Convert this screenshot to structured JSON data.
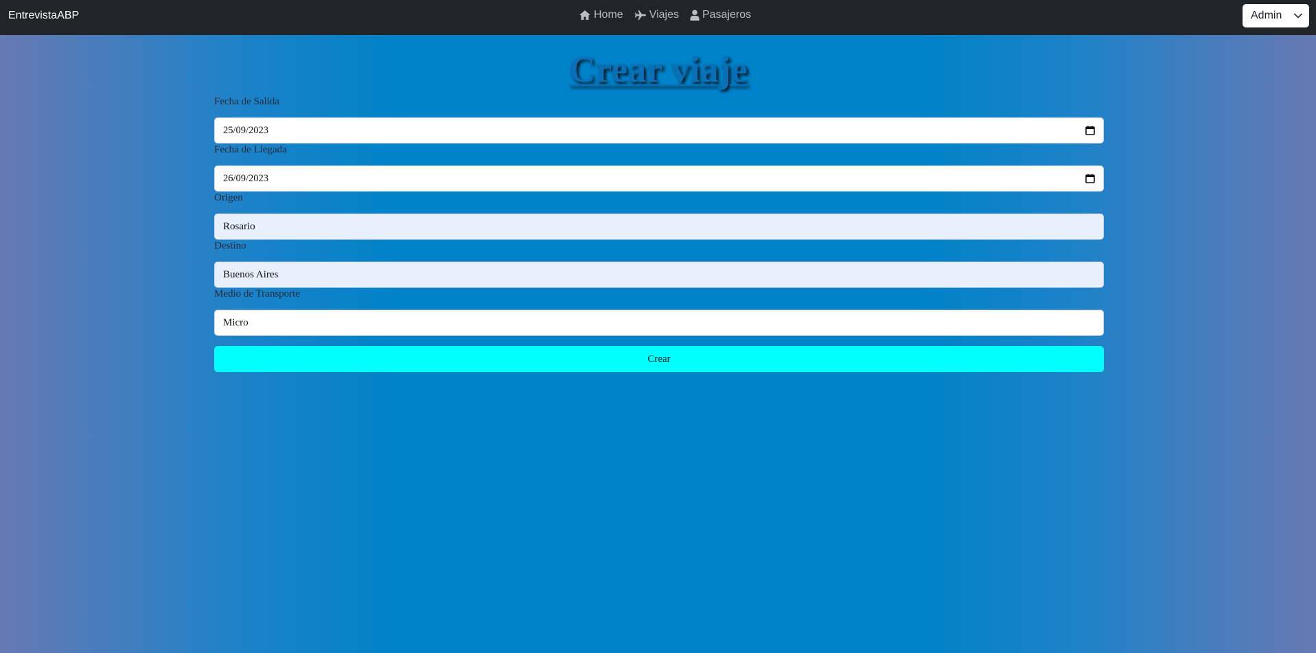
{
  "navbar": {
    "brand": "EntrevistaABP",
    "links": [
      {
        "label": "Home",
        "icon": "home-icon"
      },
      {
        "label": "Viajes",
        "icon": "plane-icon"
      },
      {
        "label": "Pasajeros",
        "icon": "user-icon"
      }
    ],
    "user_menu": {
      "selected": "Admin",
      "icon": "chevron-down-icon"
    }
  },
  "page": {
    "title": "Crear viaje"
  },
  "form": {
    "fecha_salida": {
      "label": "Fecha de Salida",
      "value": "25/09/2023"
    },
    "fecha_llegada": {
      "label": "Fecha de Llegada",
      "value": "26/09/2023"
    },
    "origen": {
      "label": "Origen",
      "value": "Rosario"
    },
    "destino": {
      "label": "Destino",
      "value": "Buenos Aires"
    },
    "medio_transporte": {
      "label": "Medio de Transporte",
      "value": "Micro"
    },
    "submit_label": "Crear"
  },
  "colors": {
    "navbar_bg": "#212529",
    "page_bg_center": "#0082c8",
    "page_bg_edge": "#6779b3",
    "submit_bg": "#00ffff",
    "autofill_bg": "#e8f0fe"
  }
}
